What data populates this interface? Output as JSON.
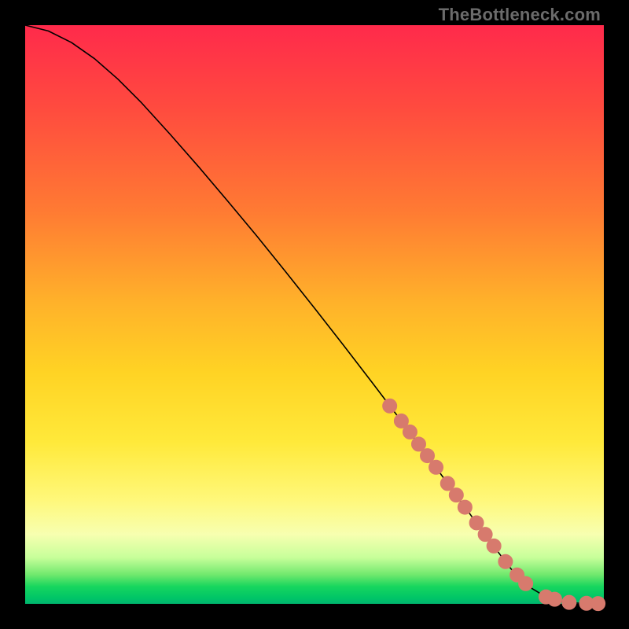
{
  "watermark": "TheBottleneck.com",
  "chart_data": {
    "type": "line",
    "title": "",
    "xlabel": "",
    "ylabel": "",
    "xlim": [
      0,
      100
    ],
    "ylim": [
      0,
      100
    ],
    "grid": false,
    "legend": false,
    "series": [
      {
        "name": "bottleneck-curve",
        "x": [
          0,
          4,
          8,
          12,
          16,
          20,
          25,
          30,
          35,
          40,
          45,
          50,
          55,
          60,
          65,
          70,
          75,
          80,
          84,
          87,
          90,
          92,
          94,
          96,
          98,
          100
        ],
        "y": [
          100,
          99,
          97,
          94.2,
          90.7,
          86.7,
          81.2,
          75.5,
          69.6,
          63.6,
          57.4,
          51.1,
          44.7,
          38.2,
          31.6,
          24.9,
          18.1,
          11.2,
          6.0,
          3.0,
          1.2,
          0.5,
          0.2,
          0.1,
          0.05,
          0.0
        ]
      }
    ],
    "highlight_points": {
      "name": "highlighted-dots",
      "x": [
        63,
        65,
        66.5,
        68,
        69.5,
        71,
        73,
        74.5,
        76,
        78,
        79.5,
        81,
        83,
        85,
        86.5,
        90,
        91.5,
        94,
        97,
        99
      ],
      "y": [
        34.2,
        31.6,
        29.7,
        27.6,
        25.6,
        23.6,
        20.8,
        18.8,
        16.7,
        14.0,
        12.0,
        10.0,
        7.3,
        5.0,
        3.5,
        1.2,
        0.8,
        0.25,
        0.1,
        0.05
      ]
    },
    "colors": {
      "line": "#000000",
      "dots": "#d77a6d",
      "gradient_top": "#ff2a4b",
      "gradient_mid": "#ffe93a",
      "gradient_bottom": "#00b56e"
    }
  }
}
